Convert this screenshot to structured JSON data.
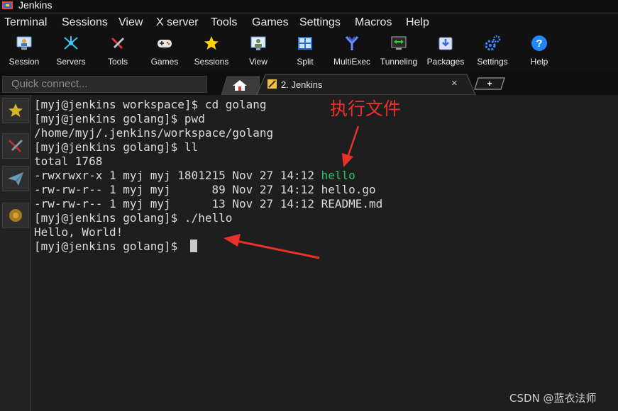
{
  "window": {
    "title": "Jenkins"
  },
  "menu": {
    "items": [
      "Terminal",
      "Sessions",
      "View",
      "X server",
      "Tools",
      "Games",
      "Settings",
      "Macros",
      "Help"
    ]
  },
  "toolbar": {
    "buttons": [
      {
        "label": "Session",
        "icon": "session-icon"
      },
      {
        "label": "Servers",
        "icon": "servers-icon"
      },
      {
        "label": "Tools",
        "icon": "tools-icon"
      },
      {
        "label": "Games",
        "icon": "gamepad-icon"
      },
      {
        "label": "Sessions",
        "icon": "star-icon"
      },
      {
        "label": "View",
        "icon": "view-icon"
      },
      {
        "label": "Split",
        "icon": "split-icon"
      },
      {
        "label": "MultiExec",
        "icon": "multiexec-icon"
      },
      {
        "label": "Tunneling",
        "icon": "tunneling-icon"
      },
      {
        "label": "Packages",
        "icon": "packages-icon"
      },
      {
        "label": "Settings",
        "icon": "gears-icon"
      },
      {
        "label": "Help",
        "icon": "help-icon"
      }
    ]
  },
  "tabs": {
    "quick_connect_placeholder": "Quick connect...",
    "session_tab": {
      "label": "2. Jenkins",
      "close": "×"
    },
    "new_tab": "+"
  },
  "sidebar": {
    "items": [
      "star-icon",
      "tools-icon",
      "send-icon",
      "macro-icon"
    ]
  },
  "terminal": {
    "lines": [
      "[myj@jenkins workspace]$ cd golang",
      "[myj@jenkins golang]$ pwd",
      "/home/myj/.jenkins/workspace/golang",
      "[myj@jenkins golang]$ ll",
      "total 1768",
      "-rwxrwxr-x 1 myj myj 1801215 Nov 27 14:12 ",
      "-rw-rw-r-- 1 myj myj      89 Nov 27 14:12 hello.go",
      "-rw-rw-r-- 1 myj myj      13 Nov 27 14:12 README.md",
      "[myj@jenkins golang]$ ./hello",
      "Hello, World!",
      "[myj@jenkins golang]$ "
    ],
    "highlight_file": "hello",
    "highlight_color": "#1ecb6b"
  },
  "annotation": {
    "text": "执行文件",
    "color": "#e8322b"
  },
  "watermark": "CSDN @蓝衣法师"
}
